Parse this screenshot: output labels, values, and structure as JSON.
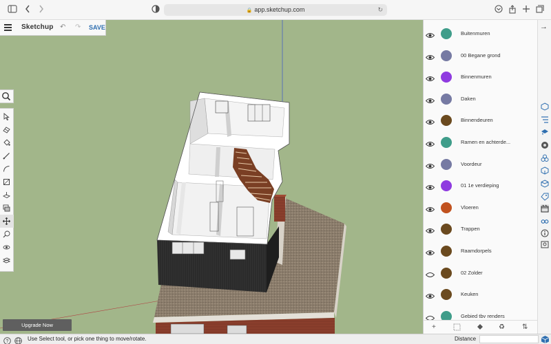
{
  "browser": {
    "url": "app.sketchup.com",
    "icons": [
      "sidebar-icon",
      "back-icon",
      "forward-icon",
      "reader-icon",
      "lock-icon",
      "reload-icon",
      "download-icon",
      "share-icon",
      "new-tab-icon",
      "tabs-icon"
    ]
  },
  "app": {
    "title": "Sketchup",
    "save_label": "SAVE",
    "upgrade_label": "Upgrade Now"
  },
  "tools": [
    "select",
    "eraser",
    "paint-bucket",
    "line",
    "arc",
    "rectangle",
    "push-pull",
    "offset",
    "move",
    "tape-measure",
    "orbit",
    "section-plane"
  ],
  "layers": [
    {
      "name": "Buitenmuren",
      "color": "#3f9d8a",
      "visible": true
    },
    {
      "name": "00 Begane grond",
      "color": "#767aa3",
      "visible": true
    },
    {
      "name": "Binnenmuren",
      "color": "#8f3be0",
      "visible": true
    },
    {
      "name": "Daken",
      "color": "#767aa3",
      "visible": true
    },
    {
      "name": "Binnendeuren",
      "color": "#6b4a1f",
      "visible": true
    },
    {
      "name": "Ramen en achterde...",
      "color": "#3f9d8a",
      "visible": true
    },
    {
      "name": "Voordeur",
      "color": "#767aa3",
      "visible": true
    },
    {
      "name": "01 1e verdieping",
      "color": "#8f3be0",
      "visible": true
    },
    {
      "name": "Vloeren",
      "color": "#c1521f",
      "visible": true
    },
    {
      "name": "Trappen",
      "color": "#6b4a1f",
      "visible": true
    },
    {
      "name": "Raamdorpels",
      "color": "#6b4a1f",
      "visible": true
    },
    {
      "name": "02 Zolder",
      "color": "#6b4a1f",
      "visible": false
    },
    {
      "name": "Keuken",
      "color": "#6b4a1f",
      "visible": true
    },
    {
      "name": "Gebied tbv renders",
      "color": "#3f9d8a",
      "visible": false
    }
  ],
  "status": {
    "hint": "Use Select tool, or pick one thing to move/rotate.",
    "distance_label": "Distance",
    "distance_value": ""
  },
  "colors": {
    "viewport_bg": "#a2b68a",
    "accent": "#2f6fb0"
  }
}
